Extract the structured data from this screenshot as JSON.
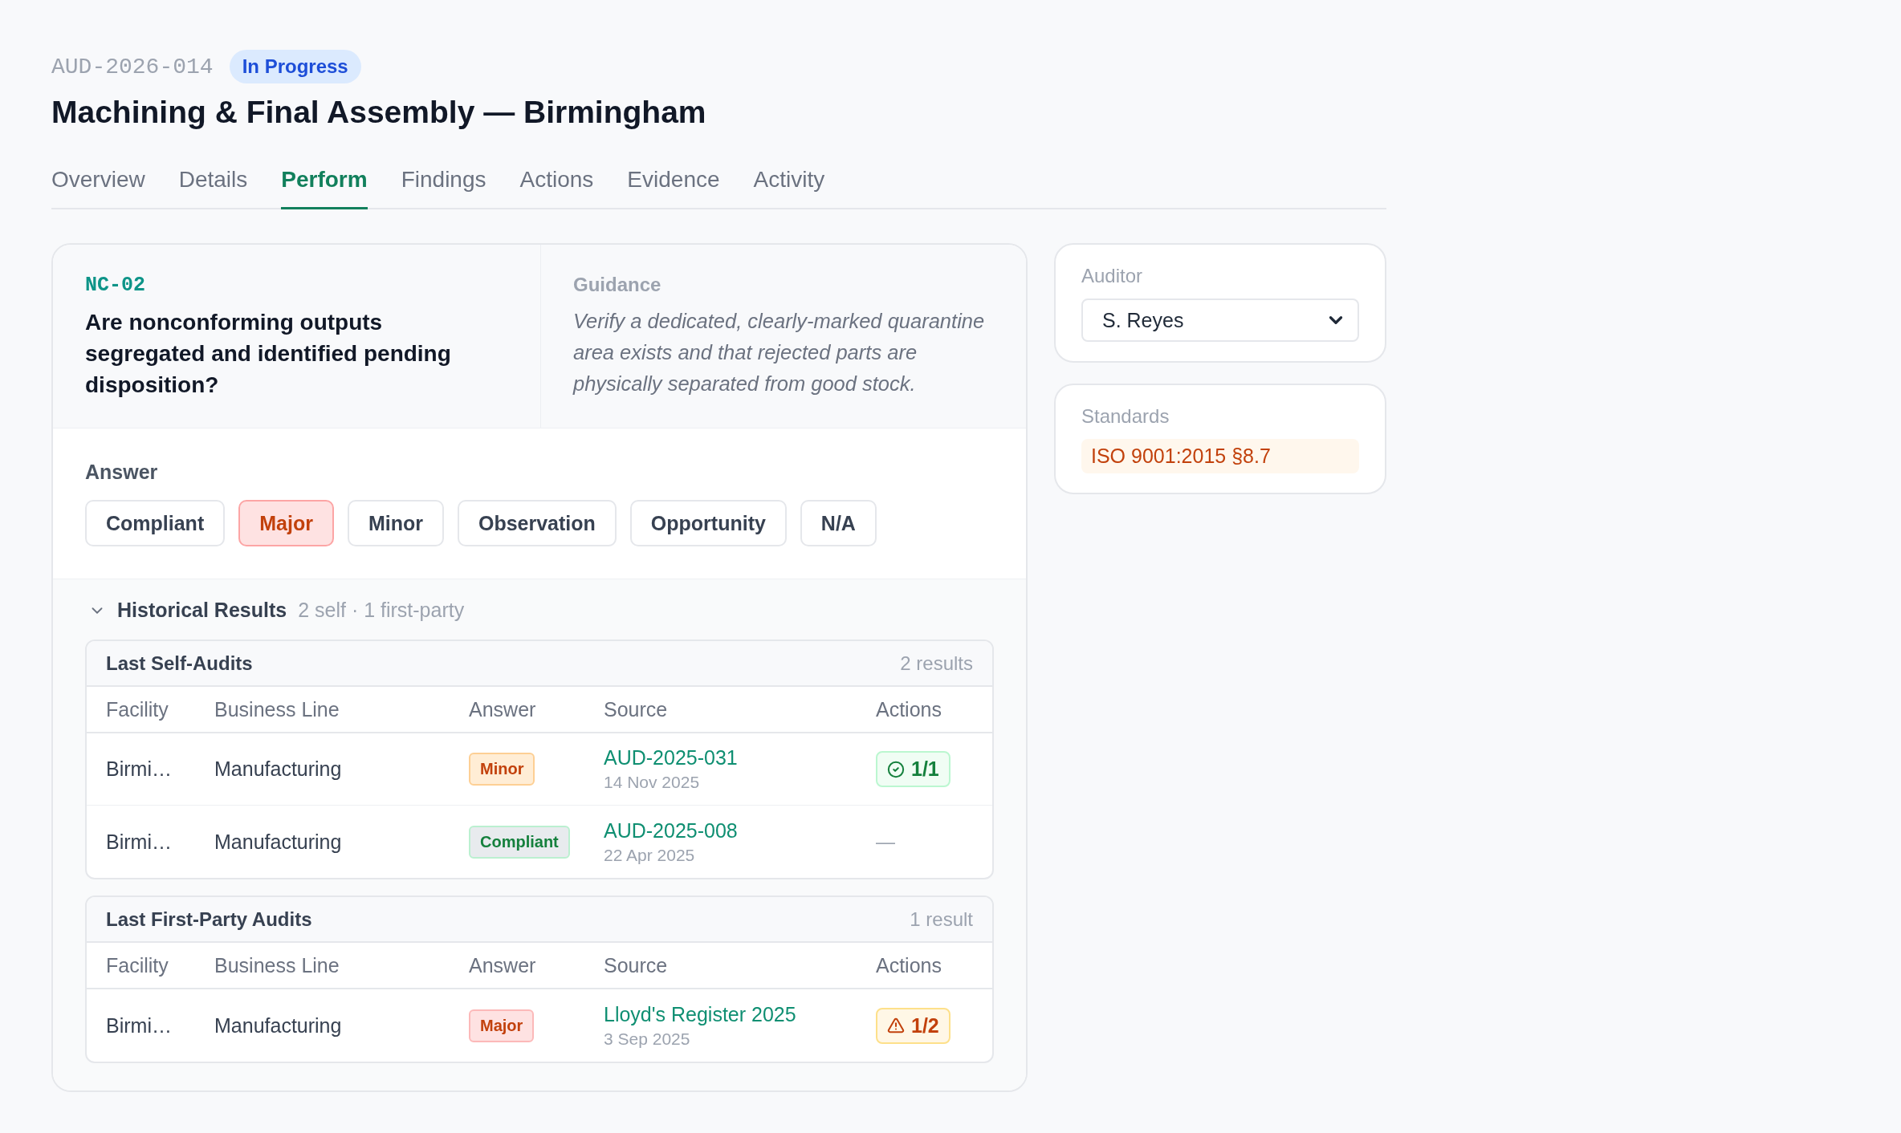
{
  "header": {
    "audit_id": "AUD-2026-014",
    "status": "In Progress",
    "title": "Machining & Final Assembly — Birmingham"
  },
  "tabs": [
    {
      "label": "Overview",
      "selected": false
    },
    {
      "label": "Details",
      "selected": false
    },
    {
      "label": "Perform",
      "selected": true
    },
    {
      "label": "Findings",
      "selected": false
    },
    {
      "label": "Actions",
      "selected": false
    },
    {
      "label": "Evidence",
      "selected": false
    },
    {
      "label": "Activity",
      "selected": false
    }
  ],
  "question": {
    "code": "NC-02",
    "text": "Are nonconforming outputs segregated and identified pending disposition?",
    "guidance_label": "Guidance",
    "guidance": "Verify a dedicated, clearly-marked quarantine area exists and that rejected parts are physically separated from good stock."
  },
  "answer": {
    "label": "Answer",
    "options": [
      {
        "label": "Compliant",
        "selected": false
      },
      {
        "label": "Major",
        "selected": true
      },
      {
        "label": "Minor",
        "selected": false
      },
      {
        "label": "Observation",
        "selected": false
      },
      {
        "label": "Opportunity",
        "selected": false
      },
      {
        "label": "N/A",
        "selected": false
      }
    ]
  },
  "historical": {
    "title": "Historical Results",
    "summary": "2 self · 1 first-party",
    "expanded": true,
    "groups": [
      {
        "title": "Last Self-Audits",
        "count": "2 results",
        "columns": [
          "Facility",
          "Business Line",
          "Answer",
          "Source",
          "Actions"
        ],
        "rows": [
          {
            "facility": "Birmi…",
            "business_line": "Manufacturing",
            "answer": {
              "kind": "minor",
              "label": "Minor"
            },
            "source": "AUD-2025-031",
            "date": "14 Nov 2025",
            "actions": {
              "kind": "done",
              "text": "1/1"
            }
          },
          {
            "facility": "Birmi…",
            "business_line": "Manufacturing",
            "answer": {
              "kind": "compliant",
              "label": "Compliant"
            },
            "source": "AUD-2025-008",
            "date": "22 Apr 2025",
            "actions": {
              "kind": "none",
              "text": "—"
            }
          }
        ]
      },
      {
        "title": "Last First-Party Audits",
        "count": "1 result",
        "columns": [
          "Facility",
          "Business Line",
          "Answer",
          "Source",
          "Actions"
        ],
        "rows": [
          {
            "facility": "Birmi…",
            "business_line": "Manufacturing",
            "answer": {
              "kind": "major",
              "label": "Major"
            },
            "source": "Lloyd's Register 2025",
            "date": "3 Sep 2025",
            "actions": {
              "kind": "warning",
              "text": "1/2"
            }
          }
        ]
      }
    ]
  },
  "sidebar": {
    "auditor": {
      "label": "Auditor",
      "value": "S. Reyes"
    },
    "standards": {
      "label": "Standards",
      "items": [
        "ISO 9001:2015 §8.7"
      ]
    }
  }
}
